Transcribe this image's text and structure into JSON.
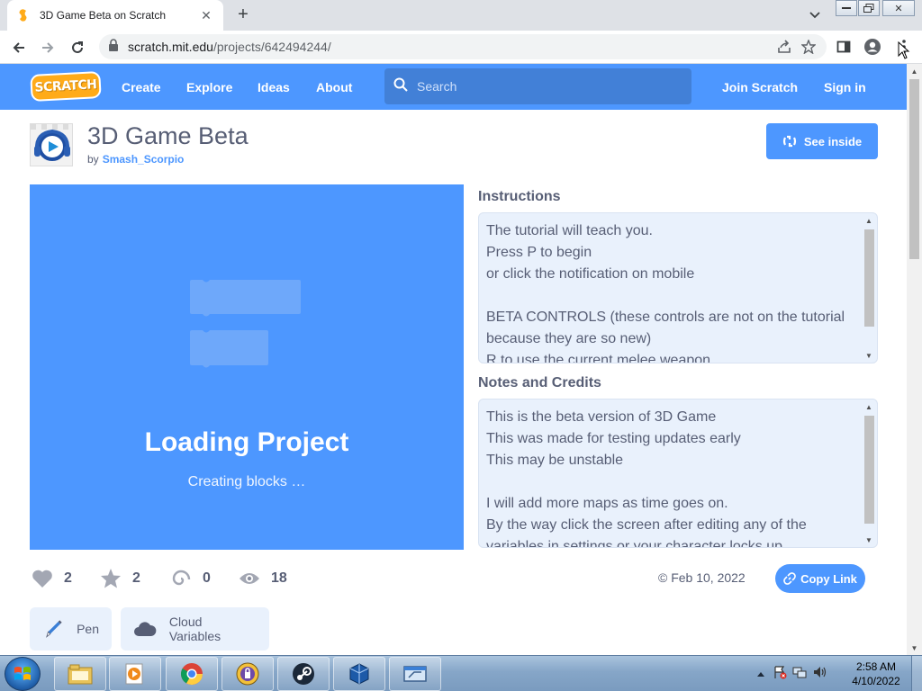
{
  "browser": {
    "tab_title": "3D Game Beta on Scratch",
    "url_host": "scratch.mit.edu",
    "url_path": "/projects/642494244/"
  },
  "scratch_nav": {
    "logo_text": "SCRATCH",
    "links": [
      "Create",
      "Explore",
      "Ideas",
      "About"
    ],
    "search_placeholder": "Search",
    "join_label": "Join Scratch",
    "signin_label": "Sign in"
  },
  "project": {
    "title": "3D Game Beta",
    "by_prefix": "by",
    "author": "Smash_Scorpio",
    "see_inside_label": "See inside",
    "loading_title": "Loading Project",
    "loading_status": "Creating blocks …"
  },
  "instructions": {
    "label": "Instructions",
    "lines": [
      "The tutorial will teach you.",
      "Press P to begin",
      "or click the notification on mobile",
      "",
      "BETA CONTROLS (these controls are not on the tutorial",
      "because they are so new)",
      "R to use the current melee weapon"
    ]
  },
  "notes": {
    "label": "Notes and Credits",
    "lines": [
      "This is the beta version of 3D Game",
      "This was made for testing updates early",
      "This may be unstable",
      "",
      "I will add more maps as time goes on.",
      "By the way click the screen after editing any of the",
      "variables in settings or your character locks up"
    ]
  },
  "stats": {
    "loves": "2",
    "favorites": "2",
    "remixes": "0",
    "views": "18"
  },
  "share_date": "© Feb 10, 2022",
  "copy_link_label": "Copy Link",
  "extensions": [
    "Pen",
    "Cloud Variables"
  ],
  "taskbar": {
    "time": "2:58 AM",
    "date": "4/10/2022"
  },
  "colors": {
    "scratch_blue": "#4d97ff",
    "scratch_orange": "#ffab19",
    "text_gray": "#575e75",
    "panel_bg": "#e9f1fc"
  }
}
